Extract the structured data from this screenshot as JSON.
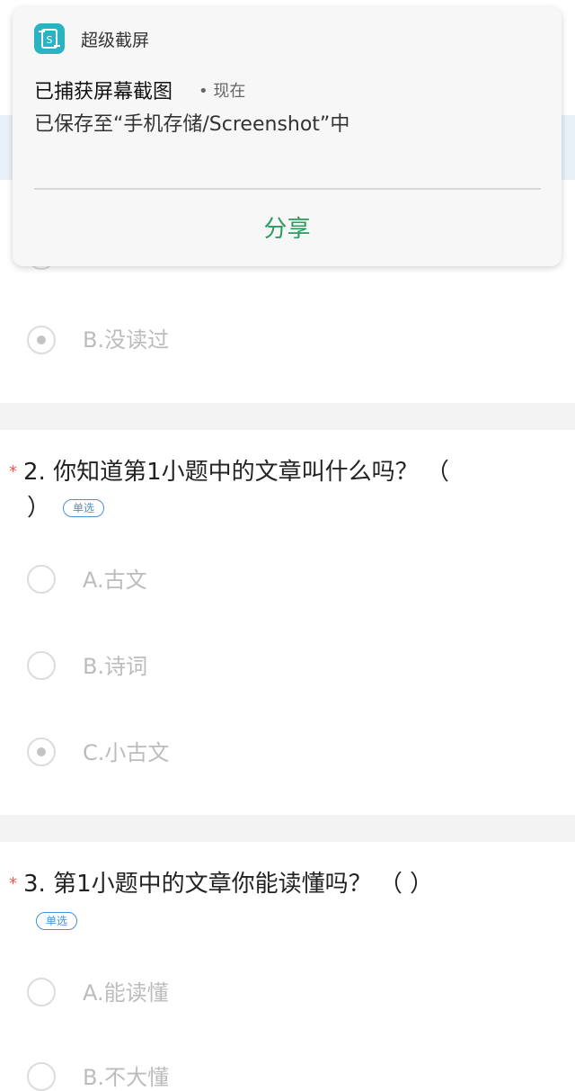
{
  "notification": {
    "app_name": "超级截屏",
    "title": "已捕获屏幕截图",
    "time": "• 现在",
    "body": "已保存至“手机存储/Screenshot”中",
    "action": "分享",
    "action_color": "#2a9c5e",
    "icon_color": "#2bb3c4"
  },
  "q1": {
    "options": [
      {
        "label": "B.没读过",
        "selected": true
      }
    ]
  },
  "q2": {
    "required_mark": "*",
    "title_line1": "2. 你知道第1小题中的文章叫什么吗？ （",
    "title_line2": "）",
    "tag": "单选",
    "options": [
      {
        "label": "A.古文",
        "selected": false
      },
      {
        "label": "B.诗词",
        "selected": false
      },
      {
        "label": "C.小古文",
        "selected": true
      }
    ]
  },
  "q3": {
    "required_mark": "*",
    "title": "3. 第1小题中的文章你能读懂吗？ （ ）",
    "tag": "单选",
    "options": [
      {
        "label": "A.能读懂",
        "selected": false
      },
      {
        "label": "B.不大懂",
        "selected": false
      }
    ]
  },
  "colors": {
    "required": "#e85a4f",
    "tag": "#4a90d9",
    "option_text": "#bcbcbc"
  }
}
